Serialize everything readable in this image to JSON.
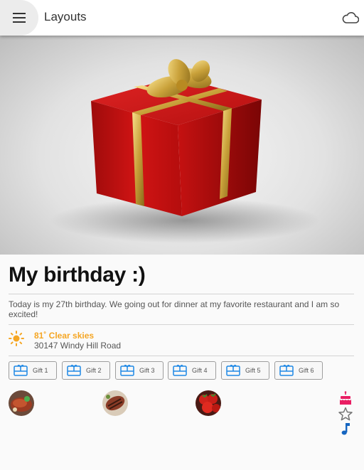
{
  "appbar": {
    "title": "Layouts",
    "menu_icon": "menu-icon",
    "action_icon": "cloud-icon"
  },
  "hero": {
    "image": "red-gift-box-with-gold-ribbon"
  },
  "card": {
    "title": "My birthday :)",
    "description": "Today is my 27th birthday. We going out for dinner at my favorite restaurant and I am so excited!",
    "weather": {
      "icon": "sun-icon",
      "summary": "81˚ Clear skies",
      "location": "30147 Windy Hill Road",
      "accent": "#f5a623"
    },
    "gifts": [
      {
        "label": "Gift 1",
        "icon": "gift-card-icon"
      },
      {
        "label": "Gift 2",
        "icon": "gift-card-icon"
      },
      {
        "label": "Gift 3",
        "icon": "gift-card-icon"
      },
      {
        "label": "Gift 4",
        "icon": "gift-card-icon"
      },
      {
        "label": "Gift 5",
        "icon": "gift-card-icon"
      },
      {
        "label": "Gift 6",
        "icon": "gift-card-icon"
      }
    ],
    "avatars": [
      "steak-photo",
      "grilled-meat-photo",
      "strawberries-photo"
    ],
    "side_actions": [
      {
        "icon": "cake-icon",
        "color": "#e91e63"
      },
      {
        "icon": "star-outline-icon",
        "color": "#757575"
      },
      {
        "icon": "music-note-icon",
        "color": "#1565c0"
      }
    ]
  }
}
